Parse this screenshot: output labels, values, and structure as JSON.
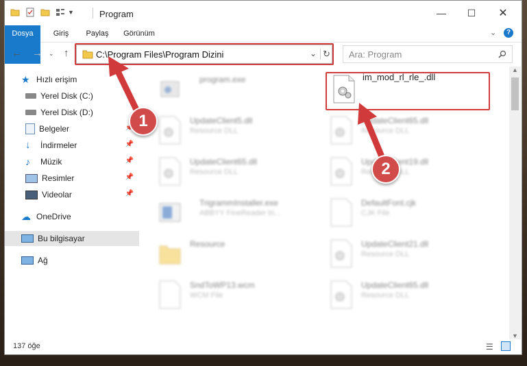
{
  "window": {
    "title": "Program",
    "controls": [
      "minimize-icon",
      "maximize-icon",
      "close-icon"
    ]
  },
  "ribbon": {
    "tabs": [
      "Dosya",
      "Giriş",
      "Paylaş",
      "Görünüm"
    ]
  },
  "navigation": {
    "address": "C:\\Program Files\\Program Dizini",
    "search_placeholder": "Ara: Program"
  },
  "sidebar": {
    "items": [
      {
        "label": "Hızlı erişim",
        "icon": "star-icon"
      },
      {
        "label": "Yerel Disk (C:)",
        "icon": "drive-icon"
      },
      {
        "label": "Yerel Disk (D:)",
        "icon": "drive-icon"
      },
      {
        "label": "Belgeler",
        "icon": "document-icon"
      },
      {
        "label": "İndirmeler",
        "icon": "download-icon"
      },
      {
        "label": "Müzik",
        "icon": "music-icon"
      },
      {
        "label": "Resimler",
        "icon": "pictures-icon"
      },
      {
        "label": "Videolar",
        "icon": "video-icon"
      },
      {
        "label": "OneDrive",
        "icon": "cloud-icon"
      },
      {
        "label": "Bu bilgisayar",
        "icon": "computer-icon"
      },
      {
        "label": "Ağ",
        "icon": "network-icon"
      }
    ]
  },
  "files": [
    {
      "name": "program.exe",
      "desc": ""
    },
    {
      "name": "im_mod_rl_rle_.dll",
      "desc": ""
    },
    {
      "name": "UpdateClient5.dll",
      "desc": "Resource DLL"
    },
    {
      "name": "UpdateClient65.dll",
      "desc": "Resource DLL"
    },
    {
      "name": "UpdateClient65.dll",
      "desc": "Resource DLL"
    },
    {
      "name": "UpdateClient19.dll",
      "desc": "Resource DLL"
    },
    {
      "name": "TrigrammInstaller.exe",
      "desc": "ABBYY FineReader tri..."
    },
    {
      "name": "DefaultFont.cjk",
      "desc": "CJK File"
    },
    {
      "name": "Resource",
      "desc": ""
    },
    {
      "name": "UpdateClient21.dll",
      "desc": "Resource DLL"
    },
    {
      "name": "SndToWP13.wcm",
      "desc": "WCM File"
    },
    {
      "name": "UpdateClient65.dll",
      "desc": "Resource DLL"
    }
  ],
  "status": {
    "count": "137 öğe"
  },
  "annotations": [
    "1",
    "2"
  ],
  "colors": {
    "accent": "#1979ca",
    "highlight": "#d13a3a"
  }
}
